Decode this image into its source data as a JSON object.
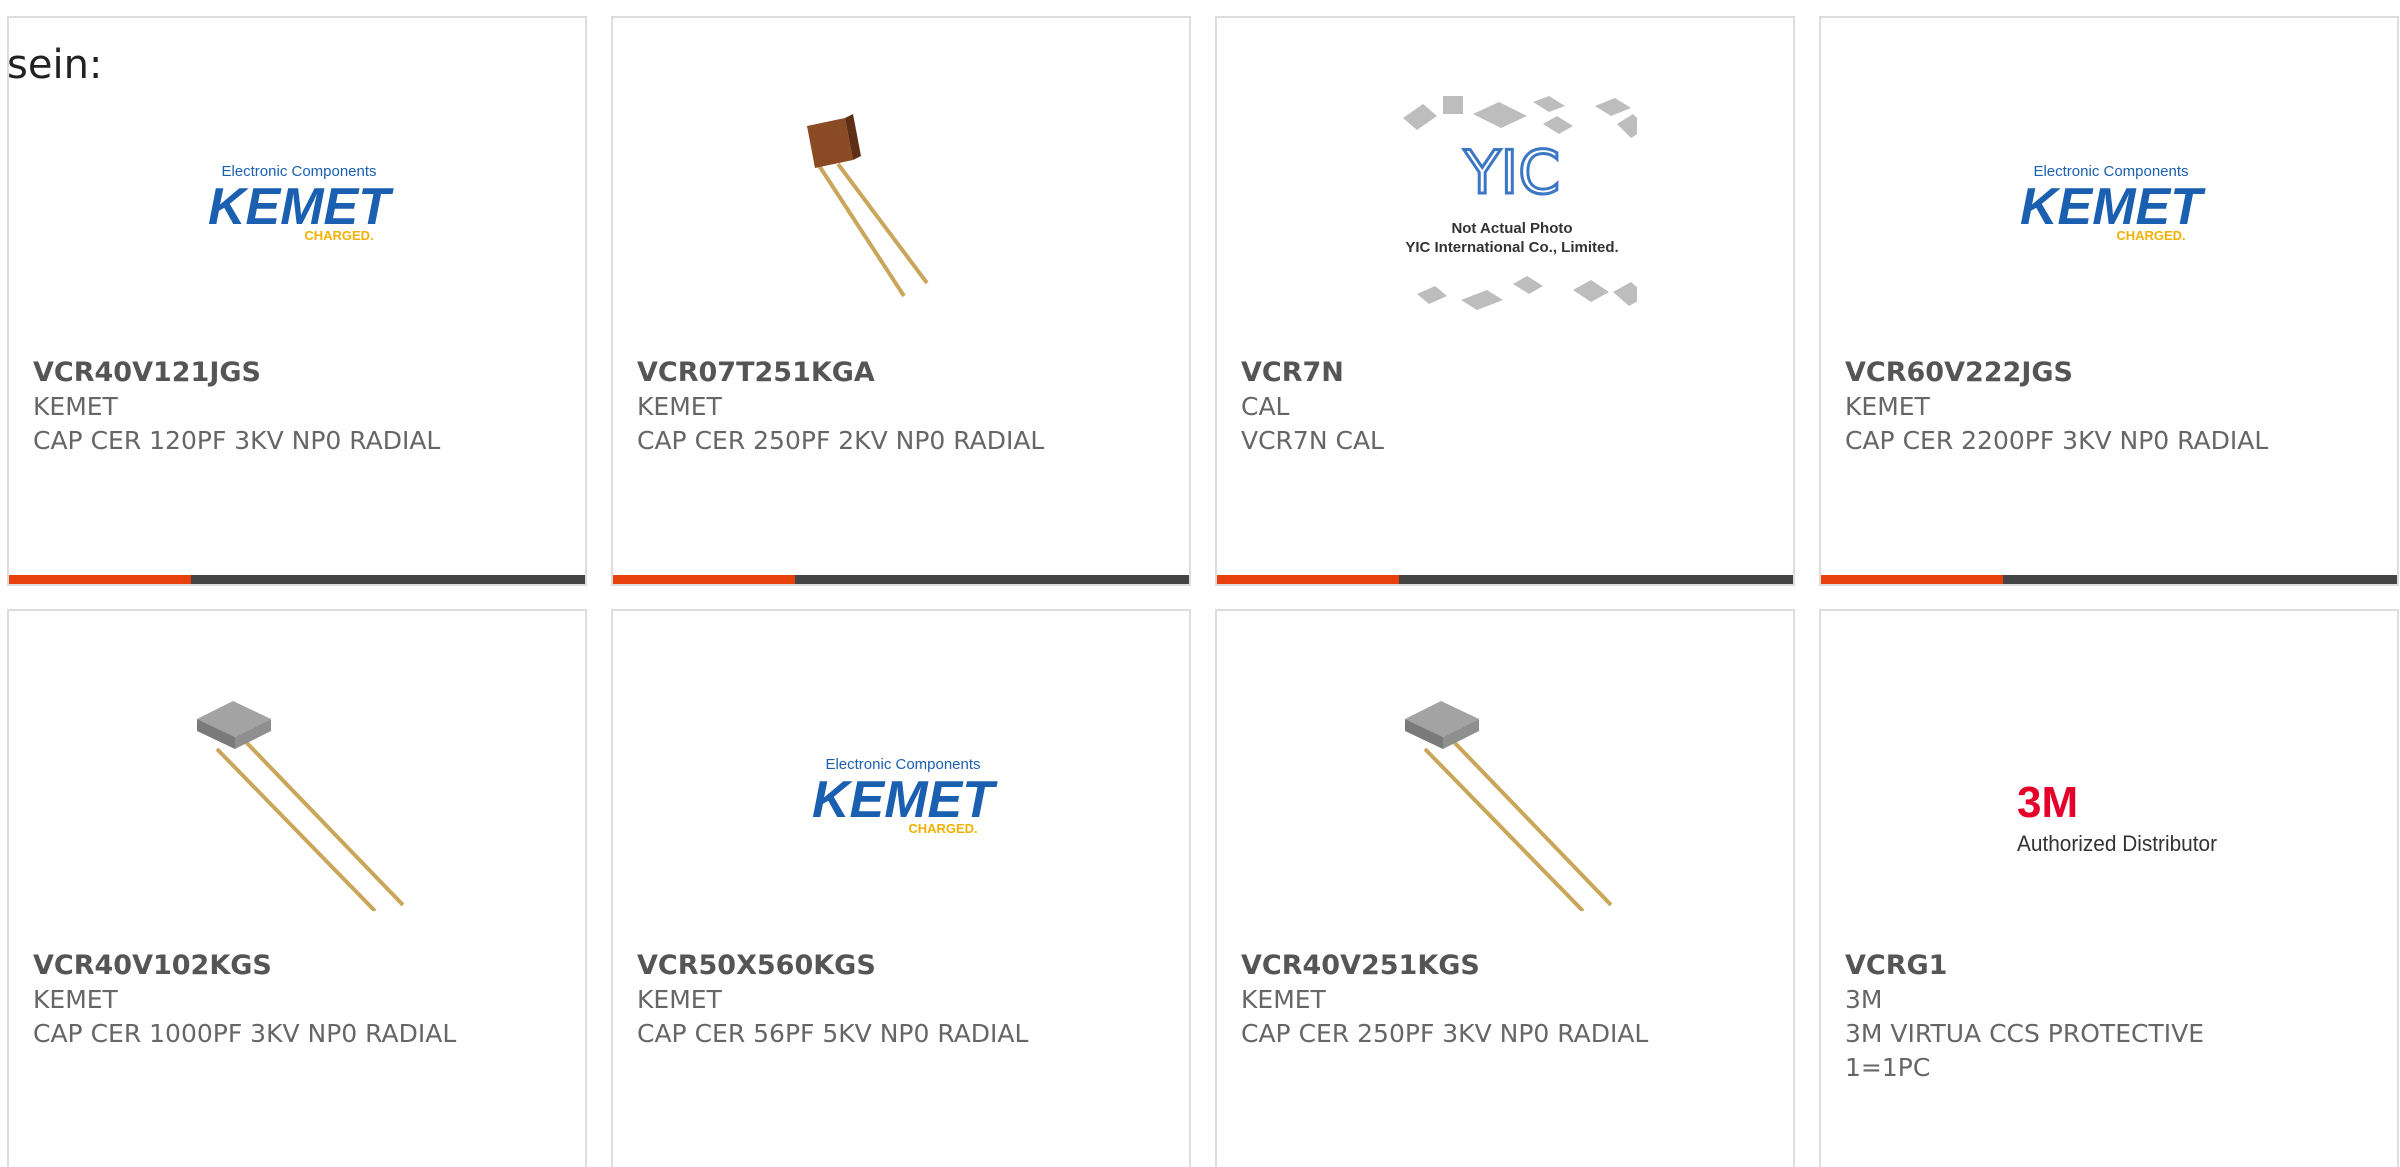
{
  "intro_text": "sein:",
  "colors": {
    "accent": "#e8400c",
    "bar": "#444444",
    "kemet_blue": "#1a5fb0",
    "kemet_yellow": "#f2b100",
    "threem_red": "#e4002b"
  },
  "products": [
    {
      "part": "VCR40V121JGS",
      "manufacturer": "KEMET",
      "description": "CAP CER 120PF 3KV NP0 RADIAL",
      "image": "kemet-logo",
      "logo": {
        "top": "Electronic Components",
        "main": "KEMET",
        "sub": "CHARGED."
      }
    },
    {
      "part": "VCR07T251KGA",
      "manufacturer": "KEMET",
      "description": "CAP CER 250PF 2KV NP0 RADIAL",
      "image": "capacitor-brown"
    },
    {
      "part": "VCR7N",
      "manufacturer": "CAL",
      "description": "VCR7N CAL",
      "image": "yic-placeholder",
      "placeholder": {
        "mark": "YIC",
        "line1": "Not Actual Photo",
        "line2": "YIC International Co., Limited."
      }
    },
    {
      "part": "VCR60V222JGS",
      "manufacturer": "KEMET",
      "description": "CAP CER 2200PF 3KV NP0 RADIAL",
      "image": "kemet-logo",
      "logo": {
        "top": "Electronic Components",
        "main": "KEMET",
        "sub": "CHARGED."
      }
    },
    {
      "part": "VCR40V102KGS",
      "manufacturer": "KEMET",
      "description": "CAP CER 1000PF 3KV NP0 RADIAL",
      "image": "capacitor-gray"
    },
    {
      "part": "VCR50X560KGS",
      "manufacturer": "KEMET",
      "description": "CAP CER 56PF 5KV NP0 RADIAL",
      "image": "kemet-logo",
      "logo": {
        "top": "Electronic Components",
        "main": "KEMET",
        "sub": "CHARGED."
      }
    },
    {
      "part": "VCR40V251KGS",
      "manufacturer": "KEMET",
      "description": "CAP CER 250PF 3KV NP0 RADIAL",
      "image": "capacitor-gray"
    },
    {
      "part": "VCRG1",
      "manufacturer": "3M",
      "description": "3M VIRTUA CCS PROTECTIVE 1=1PC",
      "image": "3m-logo",
      "logo": {
        "main": "3M",
        "sub": "Authorized Distributor"
      }
    }
  ]
}
